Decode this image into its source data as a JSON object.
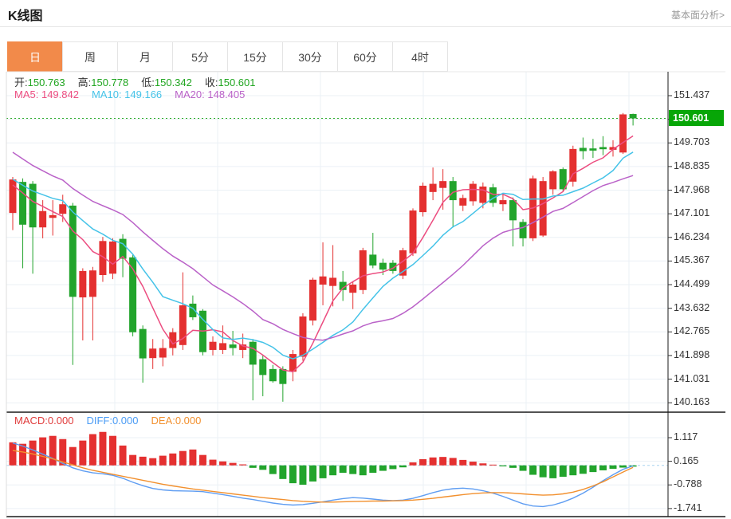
{
  "header": {
    "title": "K线图",
    "link": "基本面分析>"
  },
  "tabs": {
    "items": [
      "日",
      "周",
      "月",
      "5分",
      "15分",
      "30分",
      "60分",
      "4时"
    ],
    "selected_index": 0
  },
  "info": {
    "open_label": "开:",
    "open": "150.763",
    "high_label": "高:",
    "high": "150.778",
    "low_label": "低:",
    "low": "150.342",
    "close_label": "收:",
    "close": "150.601",
    "ma5_label": "MA5:",
    "ma5": "149.842",
    "ma10_label": "MA10:",
    "ma10": "149.166",
    "ma20_label": "MA20:",
    "ma20": "148.405"
  },
  "macd_info": {
    "macd_label": "MACD:",
    "macd": "0.000",
    "diff_label": "DIFF:",
    "diff": "0.000",
    "dea_label": "DEA:",
    "dea": "0.000"
  },
  "colors": {
    "up": "#e43030",
    "down": "#22a42c",
    "ma5": "#ec4d80",
    "ma10": "#45c3e8",
    "ma20": "#ba62c8",
    "diff_line": "#5f9df2",
    "dea_line": "#f2902e",
    "dotted_price": "#2fae2f",
    "grid": "#ebf0f6",
    "zero_dash": "#a9d3ef",
    "tag_bg": "#07a607",
    "tab_active": "#f28a4a",
    "axis_ink": "#222222"
  },
  "chart_data": [
    {
      "type": "candlestick",
      "title": "K线图 日线 (daily K-line)",
      "legend": [
        "MA5",
        "MA10",
        "MA20"
      ],
      "grid": true,
      "y_axis_side": "right",
      "ylim": [
        139.8,
        152.3
      ],
      "y_axis_labels": [
        "151.437",
        "150.601",
        "149.703",
        "148.835",
        "147.968",
        "147.101",
        "146.234",
        "145.367",
        "144.499",
        "143.632",
        "142.765",
        "141.898",
        "141.031",
        "140.163"
      ],
      "current_price_slot": 1,
      "current_price": 150.601,
      "current_price_label": "150.601",
      "candle_format": [
        "open",
        "high",
        "low",
        "close"
      ],
      "ma_periods": [
        5,
        10,
        20
      ],
      "ma_seed_closes": [
        151.8,
        151.6,
        151.4,
        151.1,
        150.8,
        150.5,
        150.2,
        149.9,
        149.6,
        149.3,
        149.1,
        148.9,
        148.7,
        148.55,
        148.4,
        148.3,
        148.2,
        148.15,
        148.1,
        148.0
      ],
      "candles": [
        [
          147.13,
          148.45,
          146.5,
          148.36
        ],
        [
          148.27,
          148.4,
          145.1,
          146.7
        ],
        [
          148.2,
          148.3,
          144.9,
          146.6
        ],
        [
          146.6,
          147.6,
          146.2,
          147.2
        ],
        [
          146.95,
          147.6,
          146.3,
          147.05
        ],
        [
          147.1,
          147.8,
          146.8,
          147.45
        ],
        [
          147.4,
          147.5,
          141.55,
          144.05
        ],
        [
          144.03,
          145.1,
          142.45,
          145.0
        ],
        [
          144.05,
          145.15,
          142.45,
          145.02
        ],
        [
          144.85,
          146.25,
          144.6,
          146.1
        ],
        [
          144.9,
          146.2,
          144.7,
          146.08
        ],
        [
          146.18,
          146.35,
          144.77,
          145.45
        ],
        [
          145.5,
          145.6,
          142.6,
          142.75
        ],
        [
          142.87,
          143.0,
          140.9,
          141.79
        ],
        [
          141.8,
          142.5,
          141.4,
          142.15
        ],
        [
          141.82,
          142.5,
          141.5,
          142.17
        ],
        [
          142.17,
          142.9,
          141.9,
          142.75
        ],
        [
          142.28,
          144.95,
          142.1,
          143.74
        ],
        [
          143.8,
          144.1,
          143.2,
          143.3
        ],
        [
          143.54,
          143.6,
          141.9,
          142.02
        ],
        [
          142.1,
          142.6,
          141.9,
          142.4
        ],
        [
          142.1,
          143.0,
          141.95,
          142.35
        ],
        [
          142.3,
          142.8,
          141.9,
          142.17
        ],
        [
          142.1,
          142.7,
          141.8,
          142.3
        ],
        [
          142.4,
          142.5,
          140.25,
          141.56
        ],
        [
          141.76,
          141.9,
          140.4,
          141.18
        ],
        [
          141.4,
          141.55,
          140.9,
          140.95
        ],
        [
          141.4,
          141.5,
          140.2,
          140.85
        ],
        [
          141.3,
          142.1,
          140.95,
          141.95
        ],
        [
          141.85,
          143.45,
          141.7,
          143.33
        ],
        [
          143.18,
          144.75,
          143.0,
          144.68
        ],
        [
          144.5,
          146.05,
          143.74,
          144.8
        ],
        [
          144.45,
          145.95,
          143.7,
          144.75
        ],
        [
          144.6,
          145.0,
          143.9,
          144.3
        ],
        [
          144.2,
          144.6,
          143.6,
          144.5
        ],
        [
          144.3,
          145.85,
          144.15,
          145.76
        ],
        [
          145.6,
          146.4,
          145.1,
          145.2
        ],
        [
          145.3,
          145.45,
          144.85,
          145.05
        ],
        [
          145.3,
          145.4,
          144.9,
          145.0
        ],
        [
          144.83,
          145.85,
          144.7,
          145.76
        ],
        [
          145.65,
          147.3,
          145.55,
          147.22
        ],
        [
          147.16,
          148.25,
          147.0,
          148.13
        ],
        [
          147.9,
          148.8,
          147.6,
          148.2
        ],
        [
          148.05,
          148.74,
          147.25,
          148.3
        ],
        [
          148.3,
          148.45,
          146.6,
          147.6
        ],
        [
          147.4,
          147.8,
          147.2,
          147.68
        ],
        [
          147.56,
          148.3,
          147.4,
          148.2
        ],
        [
          147.5,
          148.25,
          147.3,
          148.1
        ],
        [
          148.07,
          148.2,
          147.35,
          147.5
        ],
        [
          147.45,
          147.85,
          147.2,
          147.6
        ],
        [
          147.6,
          147.7,
          145.9,
          146.86
        ],
        [
          146.8,
          146.9,
          145.9,
          146.2
        ],
        [
          146.2,
          148.5,
          146.1,
          148.4
        ],
        [
          146.3,
          148.45,
          146.25,
          148.3
        ],
        [
          148.0,
          148.7,
          147.8,
          148.66
        ],
        [
          148.74,
          148.8,
          147.9,
          148.0
        ],
        [
          148.28,
          149.6,
          148.1,
          149.48
        ],
        [
          149.52,
          149.9,
          149.1,
          149.4
        ],
        [
          149.5,
          149.85,
          149.15,
          149.42
        ],
        [
          149.55,
          149.95,
          149.25,
          149.47
        ],
        [
          149.45,
          149.8,
          149.2,
          149.55
        ],
        [
          149.35,
          150.8,
          149.3,
          150.75
        ],
        [
          150.763,
          150.778,
          150.342,
          150.601
        ]
      ]
    },
    {
      "type": "bar",
      "title": "MACD (12,26,9)",
      "y_axis_labels": [
        "1.117",
        "0.165",
        "-0.788",
        "-1.741"
      ],
      "series": [
        {
          "name": "MACD histogram",
          "values": [
            0.93,
            0.87,
            1.0,
            1.13,
            1.19,
            1.06,
            0.74,
            1.0,
            1.26,
            1.35,
            1.19,
            0.8,
            0.42,
            0.35,
            0.29,
            0.39,
            0.48,
            0.58,
            0.64,
            0.42,
            0.23,
            0.16,
            0.1,
            0.04,
            -0.1,
            -0.18,
            -0.35,
            -0.55,
            -0.72,
            -0.78,
            -0.65,
            -0.52,
            -0.4,
            -0.3,
            -0.35,
            -0.4,
            -0.3,
            -0.22,
            -0.15,
            -0.08,
            0.12,
            0.25,
            0.32,
            0.34,
            0.3,
            0.22,
            0.15,
            0.08,
            0.03,
            -0.04,
            -0.1,
            -0.22,
            -0.38,
            -0.48,
            -0.52,
            -0.46,
            -0.4,
            -0.34,
            -0.27,
            -0.2,
            -0.14,
            -0.09,
            -0.05
          ]
        },
        {
          "name": "DIFF",
          "values": [
            0.9,
            0.78,
            0.62,
            0.45,
            0.28,
            0.08,
            -0.1,
            -0.22,
            -0.3,
            -0.34,
            -0.4,
            -0.52,
            -0.68,
            -0.82,
            -0.93,
            -0.99,
            -1.02,
            -1.03,
            -1.04,
            -1.06,
            -1.12,
            -1.18,
            -1.25,
            -1.32,
            -1.38,
            -1.45,
            -1.52,
            -1.57,
            -1.6,
            -1.58,
            -1.53,
            -1.47,
            -1.4,
            -1.34,
            -1.3,
            -1.32,
            -1.36,
            -1.4,
            -1.42,
            -1.4,
            -1.33,
            -1.22,
            -1.1,
            -1.0,
            -0.94,
            -0.92,
            -0.95,
            -1.02,
            -1.12,
            -1.25,
            -1.4,
            -1.55,
            -1.64,
            -1.66,
            -1.6,
            -1.48,
            -1.32,
            -1.12,
            -0.88,
            -0.62,
            -0.38,
            -0.16,
            -0.02
          ]
        },
        {
          "name": "DEA",
          "values": [
            0.6,
            0.54,
            0.46,
            0.36,
            0.26,
            0.14,
            0.02,
            -0.1,
            -0.2,
            -0.28,
            -0.36,
            -0.44,
            -0.52,
            -0.6,
            -0.68,
            -0.76,
            -0.83,
            -0.89,
            -0.95,
            -1.0,
            -1.05,
            -1.1,
            -1.15,
            -1.2,
            -1.25,
            -1.3,
            -1.34,
            -1.38,
            -1.42,
            -1.45,
            -1.47,
            -1.48,
            -1.48,
            -1.47,
            -1.46,
            -1.45,
            -1.44,
            -1.44,
            -1.43,
            -1.42,
            -1.4,
            -1.37,
            -1.33,
            -1.28,
            -1.23,
            -1.18,
            -1.14,
            -1.11,
            -1.1,
            -1.1,
            -1.12,
            -1.15,
            -1.18,
            -1.2,
            -1.19,
            -1.15,
            -1.08,
            -0.97,
            -0.83,
            -0.66,
            -0.47,
            -0.27,
            -0.08
          ]
        }
      ]
    }
  ]
}
